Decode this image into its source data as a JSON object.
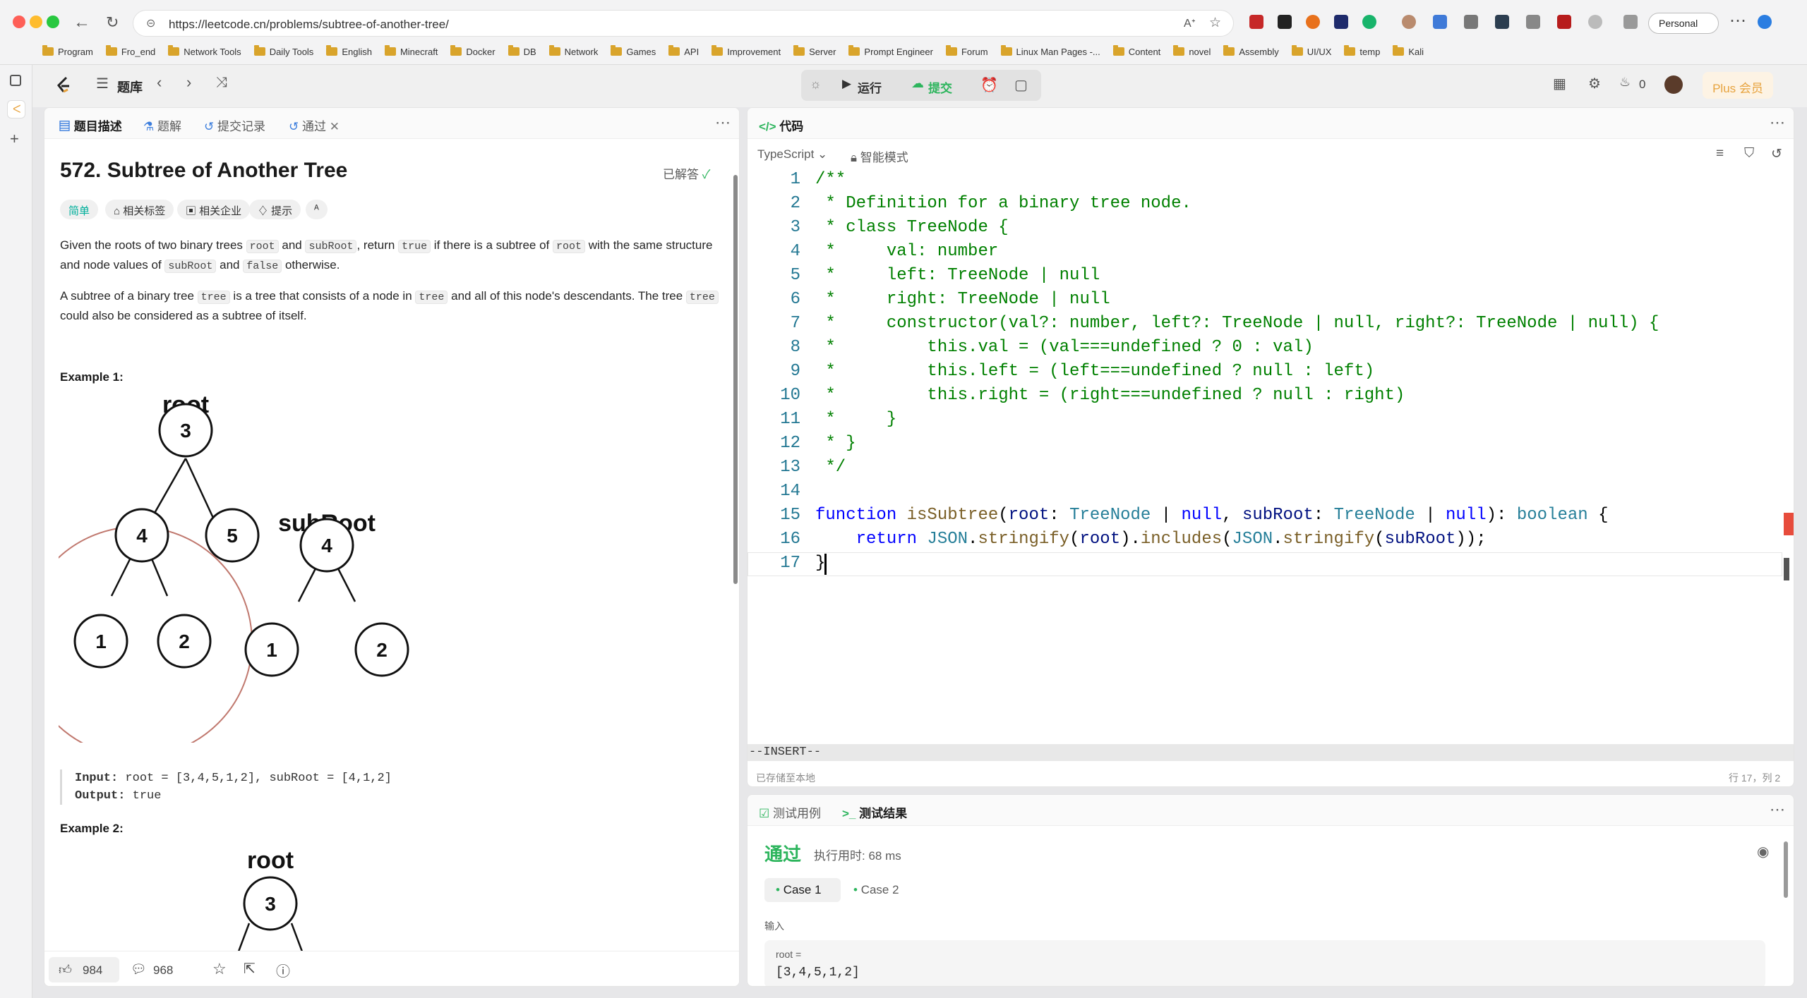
{
  "browser": {
    "url": "https://leetcode.cn/problems/subtree-of-another-tree/",
    "profile": "Personal",
    "bookmarks": [
      "Program",
      "Fro_end",
      "Network Tools",
      "Daily Tools",
      "English",
      "Minecraft",
      "Docker",
      "DB",
      "Network",
      "Games",
      "API",
      "Improvement",
      "Server",
      "Prompt Engineer",
      "Forum",
      "Linux Man Pages -...",
      "Content",
      "novel",
      "Assembly",
      "UI/UX",
      "temp",
      "Kali"
    ]
  },
  "lc_top": {
    "problem_list": "题库",
    "run": "运行",
    "submit": "提交",
    "streak": "0",
    "plus": "Plus 会员"
  },
  "left_tabs": [
    "题目描述",
    "题解",
    "提交记录",
    "通过"
  ],
  "problem": {
    "title": "572. Subtree of Another Tree",
    "status": "已解答",
    "chips": [
      "简单",
      "相关标签",
      "相关企业",
      "提示"
    ],
    "desc1_parts": [
      "Given the roots of two binary trees ",
      "root",
      " and ",
      "subRoot",
      ", return ",
      "true",
      " if there is a subtree of ",
      "root",
      " with the same structure and node values of ",
      "subRoot",
      " and ",
      "false",
      " otherwise."
    ],
    "desc2_parts": [
      "A subtree of a binary tree ",
      "tree",
      " is a tree that consists of a node in ",
      "tree",
      " and all of this node's descendants. The tree ",
      "tree",
      " could also be considered as a subtree of itself."
    ],
    "example1_title": "Example 1:",
    "example1_tree1_label": "root",
    "example1_tree2_label": "subRoot",
    "tree1_nodes": [
      "3",
      "4",
      "5",
      "1",
      "2"
    ],
    "tree2_nodes": [
      "4",
      "1",
      "2"
    ],
    "example1_input_label": "Input:",
    "example1_input": "root = [3,4,5,1,2], subRoot = [4,1,2]",
    "example1_output_label": "Output:",
    "example1_output": "true",
    "example2_title": "Example 2:",
    "example2_tree_label": "root",
    "example2_root": "3"
  },
  "bottom": {
    "likes": "984",
    "comments": "968"
  },
  "code_panel": {
    "title": "代码",
    "language": "TypeScript",
    "mode": "智能模式",
    "lines": [
      "/**",
      " * Definition for a binary tree node.",
      " * class TreeNode {",
      " *     val: number",
      " *     left: TreeNode | null",
      " *     right: TreeNode | null",
      " *     constructor(val?: number, left?: TreeNode | null, right?: TreeNode | null) {",
      " *         this.val = (val===undefined ? 0 : val)",
      " *         this.left = (left===undefined ? null : left)",
      " *         this.right = (right===undefined ? null : right)",
      " *     }",
      " * }",
      " */",
      "",
      "function isSubtree(root: TreeNode | null, subRoot: TreeNode | null): boolean {",
      "    return JSON.stringify(root).includes(JSON.stringify(subRoot));",
      "}"
    ],
    "vim_mode": "--INSERT--",
    "saved": "已存储至本地",
    "cursor": "行 17，列 2"
  },
  "test_panel": {
    "tabs": [
      "测试用例",
      "测试结果"
    ],
    "result": "通过",
    "runtime": "执行用时: 68 ms",
    "cases": [
      "Case 1",
      "Case 2"
    ],
    "input_label": "输入",
    "var_label": "root =",
    "var_value": "[3,4,5,1,2]"
  },
  "colors": {
    "accent_green": "#2db55d",
    "easy": "#00af9b",
    "plus_bg": "#fdf3e4",
    "plus_text": "#e7a33e",
    "circle": "#c0786e"
  }
}
